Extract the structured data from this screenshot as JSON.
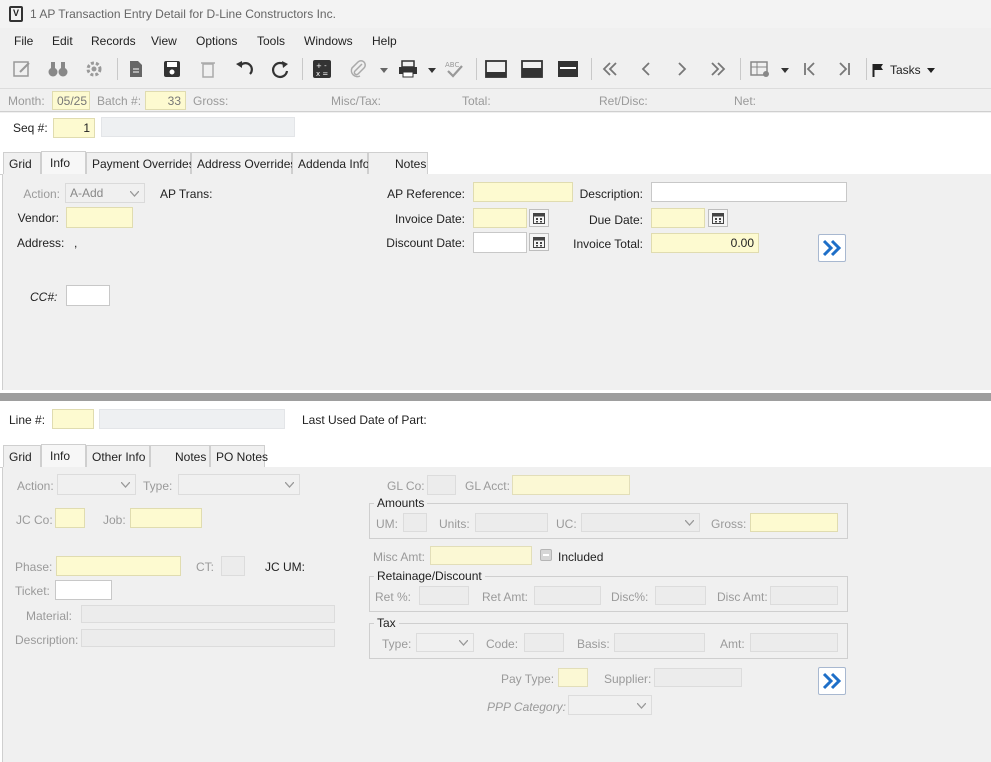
{
  "window": {
    "title": "1 AP Transaction Entry Detail for D-Line Constructors Inc."
  },
  "menu": [
    "File",
    "Edit",
    "Records",
    "View",
    "Options",
    "Tools",
    "Windows",
    "Help"
  ],
  "toolbar": {
    "tasks_label": "Tasks"
  },
  "header": {
    "month_label": "Month:",
    "month_value": "05/25",
    "batch_label": "Batch #:",
    "batch_value": "33",
    "gross_label": "Gross:",
    "misc_tax_label": "Misc/Tax:",
    "total_label": "Total:",
    "ret_disc_label": "Ret/Disc:",
    "net_label": "Net:"
  },
  "seq": {
    "label": "Seq #:",
    "value": "1"
  },
  "top_tabs": [
    "Grid",
    "Info",
    "Payment Overrides",
    "Address Overrides",
    "Addenda Info",
    "Notes"
  ],
  "top_form": {
    "action_label": "Action:",
    "action_value": "A-Add",
    "ap_trans_label": "AP Trans:",
    "vendor_label": "Vendor:",
    "address_label": "Address:",
    "address_value": ",",
    "cc_label": "CC#:",
    "ap_reference_label": "AP Reference:",
    "invoice_date_label": "Invoice Date:",
    "discount_date_label": "Discount Date:",
    "description_label": "Description:",
    "due_date_label": "Due Date:",
    "invoice_total_label": "Invoice Total:",
    "invoice_total_value": "0.00"
  },
  "line": {
    "label": "Line #:",
    "last_used_label": "Last Used Date of Part:"
  },
  "bottom_tabs": [
    "Grid",
    "Info",
    "Other Info",
    "Notes",
    "PO Notes"
  ],
  "bottom_form": {
    "action_label": "Action:",
    "type_label": "Type:",
    "jc_co_label": "JC Co:",
    "job_label": "Job:",
    "phase_label": "Phase:",
    "ct_label": "CT:",
    "jc_um_label": "JC UM:",
    "ticket_label": "Ticket:",
    "material_label": "Material:",
    "description_label": "Description:",
    "gl_co_label": "GL Co:",
    "gl_acct_label": "GL Acct:",
    "amounts_title": "Amounts",
    "um_label": "UM:",
    "units_label": "Units:",
    "uc_label": "UC:",
    "gross_label": "Gross:",
    "misc_amt_label": "Misc Amt:",
    "included_label": "Included",
    "retainage_title": "Retainage/Discount",
    "ret_pct_label": "Ret %:",
    "ret_amt_label": "Ret Amt:",
    "disc_pct_label": "Disc%:",
    "disc_amt_label": "Disc Amt:",
    "tax_title": "Tax",
    "tax_type_label": "Type:",
    "code_label": "Code:",
    "basis_label": "Basis:",
    "amt_label": "Amt:",
    "pay_type_label": "Pay Type:",
    "supplier_label": "Supplier:",
    "ppp_label": "PPP Category:"
  },
  "colors": {
    "required": "#fdfad0",
    "nav_blue": "#1e6fc8"
  }
}
